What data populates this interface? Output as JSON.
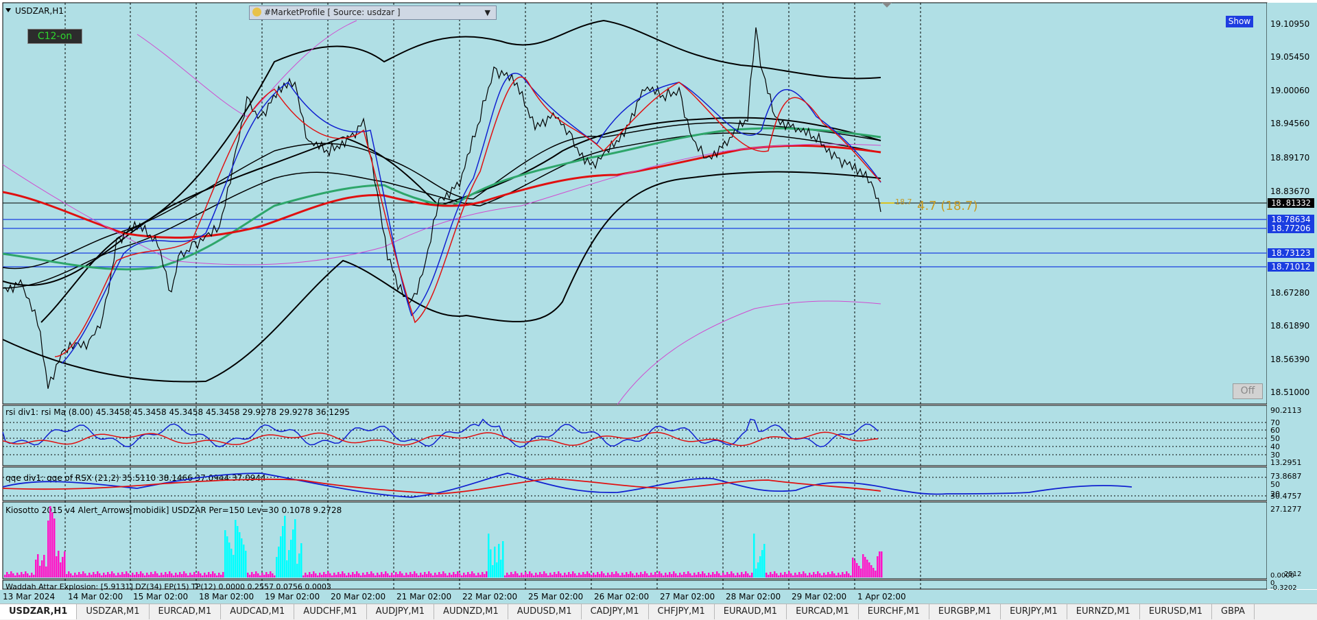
{
  "symbol_label": "USDZAR,H1",
  "market_profile": {
    "label": "#MarketProfile [ Source: usdzar ]",
    "arrow": "▼"
  },
  "c12_button": "C12-on",
  "show_button": "Show",
  "off_button": "Off",
  "price_scale": [
    "19.10950",
    "19.05450",
    "19.00060",
    "18.94560",
    "18.89170",
    "18.83670",
    "18.78634",
    "18.77206",
    "18.73123",
    "18.71012",
    "18.67280",
    "18.61890",
    "18.56390",
    "18.51000"
  ],
  "current_price": "18.81332",
  "annotation": "4.7 (18.7)",
  "annotation_small": "18.7",
  "time_scale": [
    "13 Mar 2024",
    "14 Mar 02:00",
    "15 Mar 02:00",
    "18 Mar 02:00",
    "19 Mar 02:00",
    "20 Mar 02:00",
    "21 Mar 02:00",
    "22 Mar 02:00",
    "25 Mar 02:00",
    "26 Mar 02:00",
    "27 Mar 02:00",
    "28 Mar 02:00",
    "29 Mar 02:00",
    "1 Apr 02:00"
  ],
  "rsi_panel": {
    "label": "rsi div1: rsi Ma (8.00) 45.3458 45.3458 45.3458 45.3458 29.9278 29.9278 36.1295",
    "scale": [
      "90.2113",
      "70",
      "60",
      "50",
      "40",
      "30",
      "13.2951"
    ]
  },
  "qqe_panel": {
    "label": "qqe div1: qqe of RSX (21,2) 35.5110 38.1466 37.0944 37.0944",
    "scale": [
      "73.8687",
      "50",
      "30.4757",
      "20"
    ]
  },
  "kiosotto_panel": {
    "label": "Kiosotto 2015 v4 Alert_Arrows[mobidik] USDZAR Per=150 Lev=30 0.1078 9.2728",
    "scale": [
      "27.1277",
      "0.0000",
      "2512"
    ]
  },
  "waddah_panel": {
    "label": "Waddah Attar Explosion: [5.9131] DZ(34) EP(15) TP(12) 0.0000 0.2557 0.0756 0.0003",
    "scale": [
      "0",
      "-0.3202"
    ]
  },
  "tabs": [
    "USDZAR,H1",
    "USDZAR,M1",
    "EURCAD,M1",
    "AUDCAD,M1",
    "AUDCHF,M1",
    "AUDJPY,M1",
    "AUDNZD,M1",
    "AUDUSD,M1",
    "CADJPY,M1",
    "CHFJPY,M1",
    "EURAUD,M1",
    "EURCAD,M1",
    "EURCHF,M1",
    "EURGBP,M1",
    "EURJPY,M1",
    "EURNZD,M1",
    "EURUSD,M1",
    "GBPA"
  ],
  "active_tab": 0,
  "colors": {
    "background": "#b0dfe5",
    "price_line": "#000000",
    "h_line": "#1a3de0",
    "ma_red": "#e01010",
    "ma_green": "#2ea66a",
    "ma_blue": "#1020d0",
    "ma_purple": "#8a2be2",
    "hist_magenta": "#ff14c8",
    "hist_cyan": "#00ffff"
  }
}
